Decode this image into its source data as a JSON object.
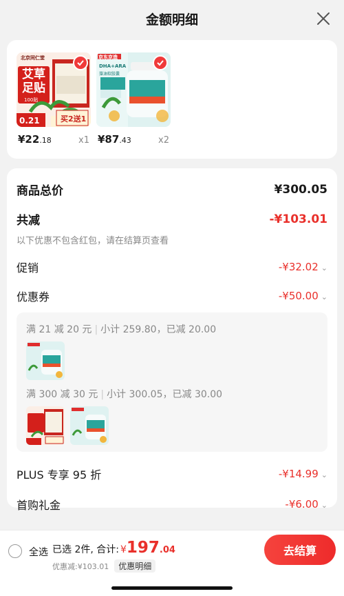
{
  "header": {
    "title": "金额明细"
  },
  "products": [
    {
      "price_main": "¥22",
      "price_dec": ".18",
      "qty": "x1"
    },
    {
      "price_main": "¥87",
      "price_dec": ".43",
      "qty": "x2"
    }
  ],
  "product1_art": {
    "brand": "北京同仁堂",
    "title1": "艾草",
    "title2": "足贴",
    "count": "100贴",
    "promo_price": "0.21",
    "promo": "买2送1"
  },
  "product2_art": {
    "brand": "京东京造",
    "line1": "DHA+ARA",
    "line2": "藻油软胶囊"
  },
  "summary": {
    "total_label": "商品总价",
    "total_value": "¥300.05",
    "reduce_label": "共减",
    "reduce_value": "-¥103.01",
    "reduce_note": "以下优惠不包含红包，请在结算页查看",
    "promo_label": "促销",
    "promo_value": "-¥32.02",
    "coupon_label": "优惠券",
    "coupon_value": "-¥50.00",
    "plus_label": "PLUS 专享 95 折",
    "plus_value": "-¥14.99",
    "gift_label": "首购礼金",
    "gift_value": "-¥6.00"
  },
  "coupons": [
    {
      "cond": "满 21 减 20 元",
      "detail": "小计 259.80，已减 20.00"
    },
    {
      "cond": "满 300 减 30 元",
      "detail": "小计 300.05，已减 30.00"
    }
  ],
  "footer": {
    "select_all": "全选",
    "selected_text": "已选 2件, 合计:",
    "yen": "¥",
    "total_main": "197",
    "total_dec": ".04",
    "saved_text": "优惠减:¥103.01",
    "detail_tag": "优惠明细",
    "checkout": "去结算"
  },
  "colors": {
    "accent": "#e9302b",
    "bg": "#f2f2f2"
  }
}
